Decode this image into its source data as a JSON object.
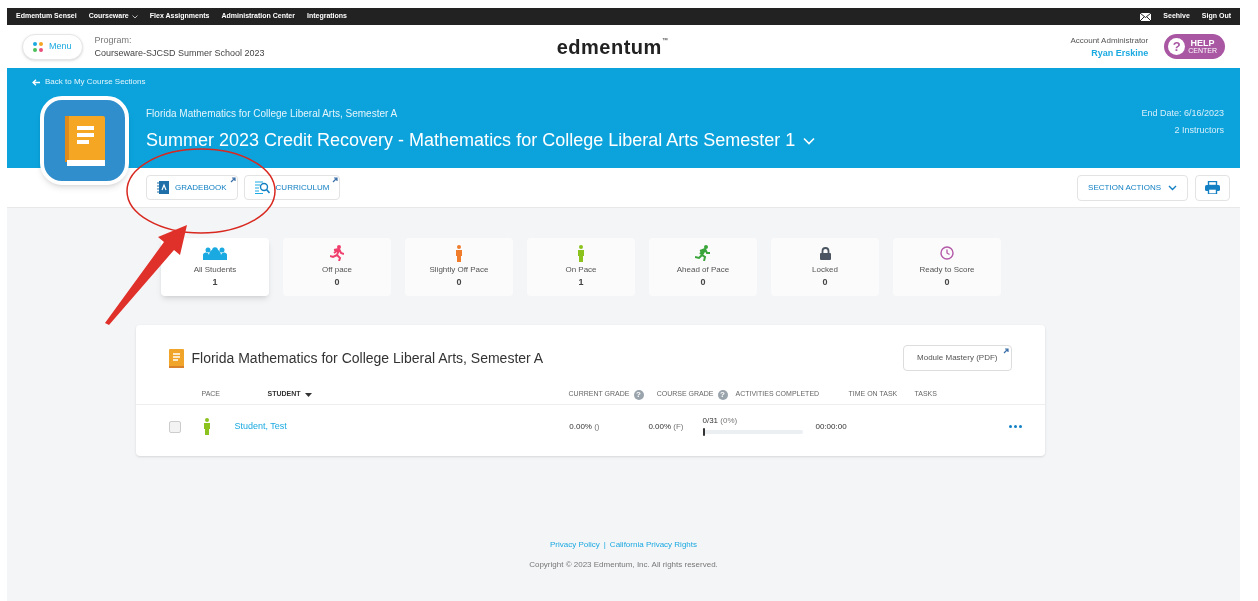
{
  "top_nav": {
    "left": [
      {
        "label": "Edmentum Sensei",
        "dropdown": false
      },
      {
        "label": "Courseware",
        "dropdown": true
      },
      {
        "label": "Flex Assignments",
        "dropdown": false
      },
      {
        "label": "Administration Center",
        "dropdown": false
      },
      {
        "label": "Integrations",
        "dropdown": false
      }
    ],
    "right": [
      "Seehive",
      "Sign Out"
    ]
  },
  "header": {
    "menu_label": "Menu",
    "program_label": "Program:",
    "program_name": "Courseware-SJCSD Summer School 2023",
    "logo": "edmentum",
    "logo_mark": "™",
    "role": "Account Administrator",
    "user": "Ryan Erskine",
    "help_icon": "?",
    "help": [
      "HELP",
      "CENTER"
    ]
  },
  "course_banner": {
    "back_link": "Back to My Course Sections",
    "course": "Florida Mathematics for College Liberal Arts, Semester A",
    "section_title": "Summer 2023 Credit Recovery - Mathematics for College Liberal Arts Semester 1",
    "end_date": "End Date: 6/16/2023",
    "instructors": "2 Instructors"
  },
  "toolbar": {
    "tabs": [
      {
        "label": "GRADEBOOK",
        "kind": "gradebook"
      },
      {
        "label": "CURRICULUM",
        "kind": "curriculum"
      }
    ],
    "section_actions": "SECTION ACTIONS"
  },
  "stats": [
    {
      "label": "All Students",
      "count": "1",
      "kind": "all",
      "selected": true
    },
    {
      "label": "Off pace",
      "count": "0",
      "kind": "off",
      "selected": false
    },
    {
      "label": "Slightly Off Pace",
      "count": "0",
      "kind": "slightly",
      "selected": false
    },
    {
      "label": "On Pace",
      "count": "1",
      "kind": "on",
      "selected": false
    },
    {
      "label": "Ahead of Pace",
      "count": "0",
      "kind": "ahead",
      "selected": false
    },
    {
      "label": "Locked",
      "count": "0",
      "kind": "locked",
      "selected": false
    },
    {
      "label": "Ready to Score",
      "count": "0",
      "kind": "ready",
      "selected": false
    }
  ],
  "table": {
    "title": "Florida Mathematics for College Liberal Arts, Semester A",
    "pdf_button": "Module Mastery (PDF)",
    "columns": [
      {
        "label": "PACE"
      },
      {
        "label": "STUDENT",
        "sort": true
      },
      {
        "label": "CURRENT GRADE",
        "help": "?"
      },
      {
        "label": "COURSE GRADE",
        "help": "?"
      },
      {
        "label": "ACTIVITIES COMPLETED"
      },
      {
        "label": "TIME ON TASK"
      },
      {
        "label": "TASKS"
      }
    ],
    "rows": [
      {
        "checked": false,
        "kind": "on",
        "student": "Student, Test",
        "current_grade": "0.00%",
        "current_letter": "()",
        "course_grade": "0.00%",
        "course_letter": "(F)",
        "activities": "0/31",
        "activities_pct": "(0%)",
        "level": 0,
        "time": "00:00:00"
      }
    ]
  },
  "footer": {
    "links": [
      "Privacy Policy",
      "California Privacy Rights"
    ],
    "separator": "|",
    "copyright": "Copyright © 2023 Edmentum, Inc. All rights reserved."
  }
}
